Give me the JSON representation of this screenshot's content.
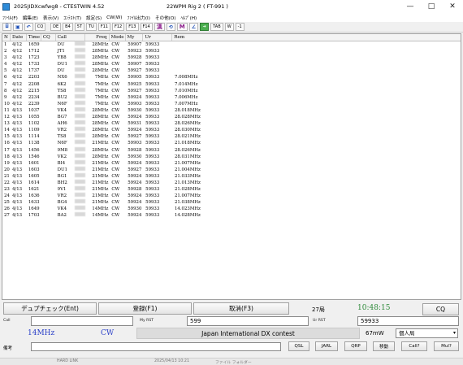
{
  "window": {
    "title": "2025JIDXcwfwg8 - CTESTWIN 4.52",
    "center_info": "22WPM  Rig 2 ( FT-991 )",
    "controls": [
      "—",
      "□",
      "✕"
    ]
  },
  "menu": [
    "ﾌｧｲﾙ(F)",
    "編集(E)",
    "表示(V)",
    "ｺﾝﾃｽﾄ(T)",
    "設定(S)",
    "CW(W)",
    "ﾌｧｲﾙ出力(I)",
    "その他(O)",
    "ﾍﾙﾌﾟ(H)"
  ],
  "toolbar": {
    "icons": [
      "open-icon",
      "save-icon",
      "undo-icon"
    ],
    "buttons": [
      "CQ",
      "DE",
      "B4",
      "5T",
      "TU",
      "F11",
      "F12",
      "F13",
      "F14"
    ],
    "tools": [
      "漢",
      "⟲",
      "M",
      "∠"
    ],
    "tail": [
      "TAB",
      "W",
      "-1"
    ]
  },
  "log": {
    "columns": [
      "N",
      "Date",
      "Time",
      "CQ",
      "Call",
      "Freq",
      "Mode",
      "My",
      "Ur",
      "Rem"
    ],
    "rows": [
      [
        "1",
        "4/12",
        "1659",
        "",
        "DU",
        "28MHz",
        "CW",
        "59907",
        "59933",
        ""
      ],
      [
        "2",
        "4/12",
        "1712",
        "",
        "JT1",
        "28MHz",
        "CW",
        "59923",
        "59933",
        ""
      ],
      [
        "3",
        "4/12",
        "1723",
        "",
        "YB8",
        "28MHz",
        "CW",
        "59928",
        "59933",
        ""
      ],
      [
        "4",
        "4/12",
        "1733",
        "",
        "DU1",
        "28MHz",
        "CW",
        "59907",
        "59933",
        ""
      ],
      [
        "5",
        "4/12",
        "1737",
        "",
        "DU",
        "28MHz",
        "CW",
        "59927",
        "59933",
        ""
      ],
      [
        "6",
        "4/12",
        "2203",
        "",
        "NX6",
        "7MHz",
        "CW",
        "59905",
        "59933",
        "7.008MHz"
      ],
      [
        "7",
        "4/12",
        "2208",
        "",
        "6K2",
        "7MHz",
        "CW",
        "59925",
        "59933",
        "7.014MHz"
      ],
      [
        "8",
        "4/12",
        "2215",
        "",
        "TS8",
        "7MHz",
        "CW",
        "59927",
        "59933",
        "7.010MHz"
      ],
      [
        "9",
        "4/12",
        "2234",
        "",
        "BU2",
        "7MHz",
        "CW",
        "59924",
        "59933",
        "7.006MHz"
      ],
      [
        "10",
        "4/12",
        "2239",
        "",
        "N6F",
        "7MHz",
        "CW",
        "59903",
        "59933",
        "7.007MHz"
      ],
      [
        "11",
        "4/13",
        "1037",
        "",
        "VK4",
        "28MHz",
        "CW",
        "59930",
        "59933",
        "28.018MHz"
      ],
      [
        "12",
        "4/13",
        "1055",
        "",
        "BG7",
        "28MHz",
        "CW",
        "59924",
        "59933",
        "28.028MHz"
      ],
      [
        "13",
        "4/13",
        "1102",
        "",
        "AH6",
        "28MHz",
        "CW",
        "59931",
        "59933",
        "28.026MHz"
      ],
      [
        "14",
        "4/13",
        "1109",
        "",
        "VR2",
        "28MHz",
        "CW",
        "59924",
        "59933",
        "28.030MHz"
      ],
      [
        "15",
        "4/13",
        "1114",
        "",
        "TS8",
        "28MHz",
        "CW",
        "59927",
        "59933",
        "28.021MHz"
      ],
      [
        "16",
        "4/13",
        "1138",
        "",
        "N6F",
        "21MHz",
        "CW",
        "59903",
        "59933",
        "21.018MHz"
      ],
      [
        "17",
        "4/13",
        "1456",
        "",
        "9M8",
        "28MHz",
        "CW",
        "59928",
        "59933",
        "28.026MHz"
      ],
      [
        "18",
        "4/13",
        "1546",
        "",
        "VK2",
        "28MHz",
        "CW",
        "59930",
        "59933",
        "28.031MHz"
      ],
      [
        "19",
        "4/13",
        "1601",
        "",
        "BI4",
        "21MHz",
        "CW",
        "59924",
        "59933",
        "21.007MHz"
      ],
      [
        "20",
        "4/13",
        "1603",
        "",
        "DU1",
        "21MHz",
        "CW",
        "59927",
        "59933",
        "21.004MHz"
      ],
      [
        "21",
        "4/13",
        "1605",
        "",
        "BG1",
        "21MHz",
        "CW",
        "59924",
        "59933",
        "21.033MHz"
      ],
      [
        "22",
        "4/13",
        "1614",
        "",
        "BH2",
        "21MHz",
        "CW",
        "59924",
        "59933",
        "21.013MHz"
      ],
      [
        "23",
        "4/13",
        "1621",
        "",
        "9V1",
        "21MHz",
        "CW",
        "59928",
        "59933",
        "21.028MHz"
      ],
      [
        "24",
        "4/13",
        "1636",
        "",
        "VR2",
        "21MHz",
        "CW",
        "59924",
        "59933",
        "21.007MHz"
      ],
      [
        "25",
        "4/13",
        "1633",
        "",
        "BG4",
        "21MHz",
        "CW",
        "59924",
        "59933",
        "21.038MHz"
      ],
      [
        "26",
        "4/13",
        "1649",
        "",
        "VK4",
        "14MHz",
        "CW",
        "59930",
        "59933",
        "14.023MHz"
      ],
      [
        "27",
        "4/13",
        "1703",
        "",
        "BA2",
        "14MHz",
        "CW",
        "59924",
        "59933",
        "14.028MHz"
      ]
    ]
  },
  "actions": {
    "dupe_check": "デュプチェック(Ent)",
    "register": "登録(F1)",
    "cancel": "取消(F3)",
    "qso_count": "27局",
    "clock": "10:48:15",
    "cq": "CQ"
  },
  "entry": {
    "call_label": "Call",
    "call_value": "",
    "my_rst_label": "My RST",
    "my_rst_value": "599",
    "ur_rst_label": "Ur RST",
    "ur_rst_value": "59933",
    "band": "14MHz",
    "mode": "CW",
    "contest": "Japan International DX contest",
    "power": "67mW",
    "category": "個人局",
    "remark_label": "備考",
    "remark_value": ""
  },
  "buttons": [
    "QSL",
    "JARL",
    "QRP",
    "移動",
    "Call?",
    "Mul?"
  ],
  "taskbar": [
    "HARD LINK",
    "2025/04/13 10:21",
    "ファイル フォルダー"
  ],
  "colors": {
    "clock": "#2e8b3a",
    "band": "#2a3fc8",
    "accent": "#1d4fb8"
  }
}
